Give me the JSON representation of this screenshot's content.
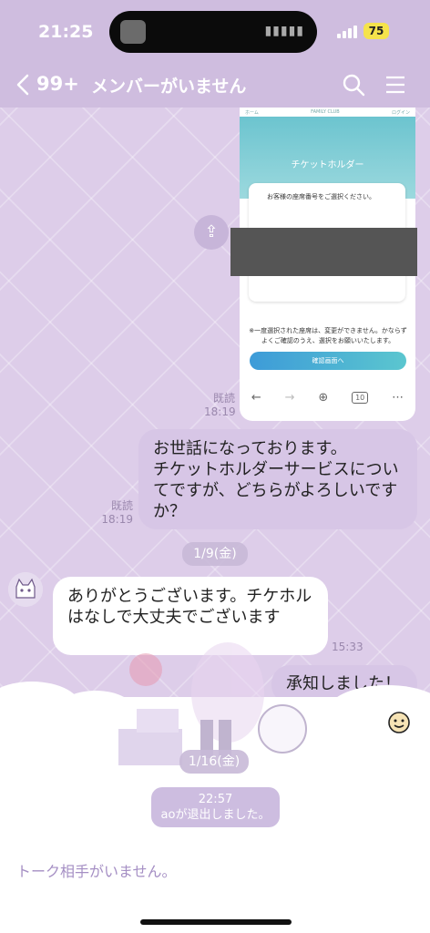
{
  "status": {
    "time": "21:25",
    "battery": "75"
  },
  "header": {
    "back_count": "99+",
    "title": "メンバーがいません"
  },
  "shot": {
    "top_left": "ホーム",
    "top_mid": "FAMILY CLUB",
    "top_right": "ログイン",
    "hero_title": "チケットホルダー",
    "panel_text": "お客様の座席番号をご選択ください。",
    "note": "※一度選択された座席は、変更ができません。かならずよくご確認のうえ、選択をお願いいたします。",
    "button": "確認画面へ",
    "tab_count": "10"
  },
  "messages": [
    {
      "read": "既読",
      "time": "18:19"
    },
    {
      "text": "お世話になっております。\nチケットホルダーサービスについてですが、どちらがよろしいですか？",
      "read": "既読",
      "time": "18:19"
    },
    {
      "date": "1/9(金)"
    },
    {
      "text": "ありがとうございます。チケホルはなしで大丈夫でございます",
      "time": "15:33"
    },
    {
      "text": "承知しました！"
    },
    {
      "date": "1/16(金)"
    },
    {
      "system_time": "22:57",
      "system_text": "aoが退出しました。"
    }
  ],
  "footer": {
    "no_member": "トーク相手がいません。"
  },
  "icons": [
    "back-chevron-icon",
    "search-icon",
    "menu-icon",
    "share-icon",
    "emoji-icon"
  ],
  "colors": {
    "header": "#cfbddf",
    "bubble_self": "#d7c6e6",
    "bubble_other": "#ffffff",
    "accent": "#a58fc4"
  }
}
